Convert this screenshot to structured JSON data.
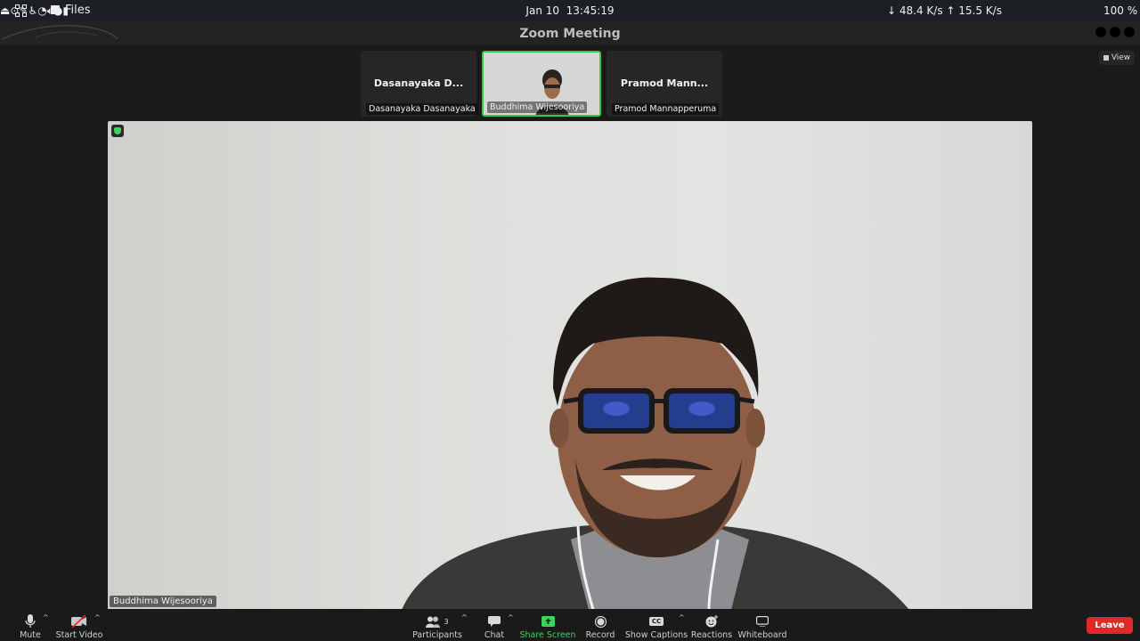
{
  "system_bar": {
    "apps_icon": "apps-grid-icon",
    "files_label": "Files",
    "date": "Jan 10",
    "time": "13:45:19",
    "net_down": "48.4 K/s",
    "net_up": "15.5 K/s",
    "battery": "100 %"
  },
  "window": {
    "title": "Zoom Meeting"
  },
  "view_button": {
    "label": "View"
  },
  "thumbnails": [
    {
      "big_name": "Dasanayaka D...",
      "label": "Dasanayaka Dasanayaka"
    },
    {
      "big_name": "",
      "label": "Buddhima Wijesooriya"
    },
    {
      "big_name": "Pramod Mann...",
      "label": "Pramod Mannapperuma"
    }
  ],
  "main_video": {
    "speaker_label": "Buddhima Wijesooriya"
  },
  "toolbar": {
    "mute": "Mute",
    "start_video": "Start Video",
    "participants": "Participants",
    "participants_count": "3",
    "chat": "Chat",
    "share_screen": "Share Screen",
    "record": "Record",
    "show_captions": "Show Captions",
    "captions_badge": "CC",
    "reactions": "Reactions",
    "whiteboard": "Whiteboard",
    "leave": "Leave"
  },
  "colors": {
    "share_green": "#3bd35a",
    "leave_red": "#e02828",
    "active_border": "#38c64b"
  }
}
